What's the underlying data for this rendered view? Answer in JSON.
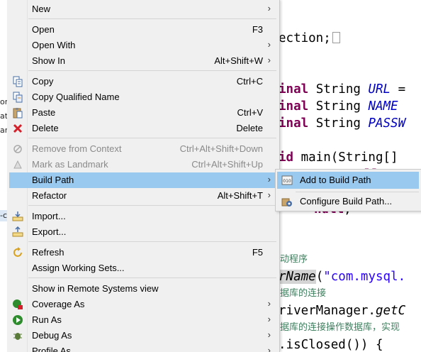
{
  "editor": {
    "left_fragments": [
      "or",
      "at",
      "ar",
      "-c"
    ],
    "lines": [
      {
        "t": "ection;"
      },
      {
        "t": "inal String URL ="
      },
      {
        "t": "inal String NAME"
      },
      {
        "t": "inal String PASSW"
      },
      {
        "t": "id main(String[]"
      },
      {
        "t": "null"
      },
      {
        "t": "null;"
      },
      {
        "t": "动程序"
      },
      {
        "t": "rName(\"com.mysql."
      },
      {
        "t": "据库的连接"
      },
      {
        "t": "riverManager.getC"
      },
      {
        "t": "据库的连接操作数据库，实现"
      },
      {
        "t": ".isClosed()) {"
      }
    ]
  },
  "menu": {
    "items": [
      {
        "label": "New",
        "accel": "",
        "submenu": true,
        "icon": ""
      },
      {
        "label": "Open",
        "accel": "F3",
        "submenu": false,
        "icon": ""
      },
      {
        "label": "Open With",
        "accel": "",
        "submenu": true,
        "icon": ""
      },
      {
        "label": "Show In",
        "accel": "Alt+Shift+W",
        "submenu": true,
        "icon": ""
      },
      {
        "label": "Copy",
        "accel": "Ctrl+C",
        "submenu": false,
        "icon": "copy-icon"
      },
      {
        "label": "Copy Qualified Name",
        "accel": "",
        "submenu": false,
        "icon": "copy-qualified-name-icon"
      },
      {
        "label": "Paste",
        "accel": "Ctrl+V",
        "submenu": false,
        "icon": "paste-icon"
      },
      {
        "label": "Delete",
        "accel": "Delete",
        "submenu": false,
        "icon": "delete-icon"
      },
      {
        "label": "Remove from Context",
        "accel": "Ctrl+Alt+Shift+Down",
        "submenu": false,
        "icon": "remove-from-context-icon",
        "disabled": true
      },
      {
        "label": "Mark as Landmark",
        "accel": "Ctrl+Alt+Shift+Up",
        "submenu": false,
        "icon": "landmark-icon",
        "disabled": true
      },
      {
        "label": "Build Path",
        "accel": "",
        "submenu": true,
        "icon": "",
        "active": true
      },
      {
        "label": "Refactor",
        "accel": "Alt+Shift+T",
        "submenu": true,
        "icon": ""
      },
      {
        "label": "Import...",
        "accel": "",
        "submenu": false,
        "icon": "import-icon"
      },
      {
        "label": "Export...",
        "accel": "",
        "submenu": false,
        "icon": "export-icon"
      },
      {
        "label": "Refresh",
        "accel": "F5",
        "submenu": false,
        "icon": "refresh-icon"
      },
      {
        "label": "Assign Working Sets...",
        "accel": "",
        "submenu": false,
        "icon": ""
      },
      {
        "label": "Show in Remote Systems view",
        "accel": "",
        "submenu": false,
        "icon": ""
      },
      {
        "label": "Coverage As",
        "accel": "",
        "submenu": true,
        "icon": "coverage-icon"
      },
      {
        "label": "Run As",
        "accel": "",
        "submenu": true,
        "icon": "run-icon"
      },
      {
        "label": "Debug As",
        "accel": "",
        "submenu": true,
        "icon": "debug-icon"
      },
      {
        "label": "Profile As",
        "accel": "",
        "submenu": true,
        "icon": ""
      }
    ]
  },
  "submenu": {
    "items": [
      {
        "label": "Add to Build Path",
        "icon": "add-to-build-path-icon",
        "active": true
      },
      {
        "label": "Configure Build Path...",
        "icon": "configure-build-path-icon"
      }
    ]
  },
  "colors": {
    "menu_bg": "#f0f0f0",
    "highlight": "#99c9ef",
    "keyword": "#7f0055",
    "field": "#0000c0",
    "string": "#2a00ff",
    "comment": "#3f7f5f"
  }
}
